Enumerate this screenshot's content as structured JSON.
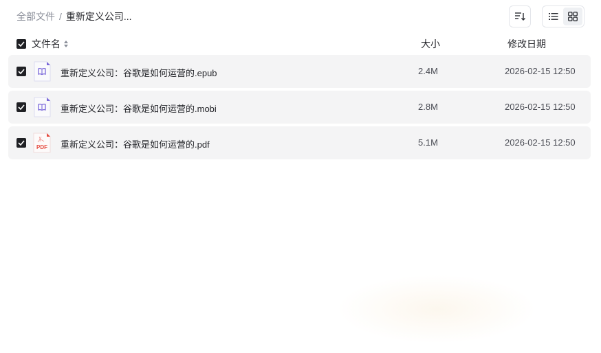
{
  "breadcrumb": {
    "root": "全部文件",
    "separator": "/",
    "current": "重新定义公司..."
  },
  "toolbar": {
    "sort_icon": "sort-icon",
    "list_view_icon": "list-view-icon",
    "grid_view_icon": "grid-view-icon",
    "active_view": "list"
  },
  "table": {
    "headers": {
      "name": "文件名",
      "size": "大小",
      "modified": "修改日期"
    },
    "all_selected": true,
    "rows": [
      {
        "name": "重新定义公司：谷歌是如何运营的.epub",
        "size": "2.4M",
        "modified": "2026-02-15 12:50",
        "type": "epub",
        "icon": "book-file-icon",
        "selected": true
      },
      {
        "name": "重新定义公司：谷歌是如何运营的.mobi",
        "size": "2.8M",
        "modified": "2026-02-15 12:50",
        "type": "mobi",
        "icon": "book-file-icon",
        "selected": true
      },
      {
        "name": "重新定义公司：谷歌是如何运营的.pdf",
        "size": "5.1M",
        "modified": "2026-02-15 12:50",
        "type": "pdf",
        "icon": "pdf-file-icon",
        "pdf_label": "PDF",
        "selected": true
      }
    ]
  },
  "colors": {
    "row_background": "#f4f4f5",
    "checkbox": "#1f2024",
    "book_icon": "#7b68d9",
    "pdf_icon": "#e5483d"
  }
}
